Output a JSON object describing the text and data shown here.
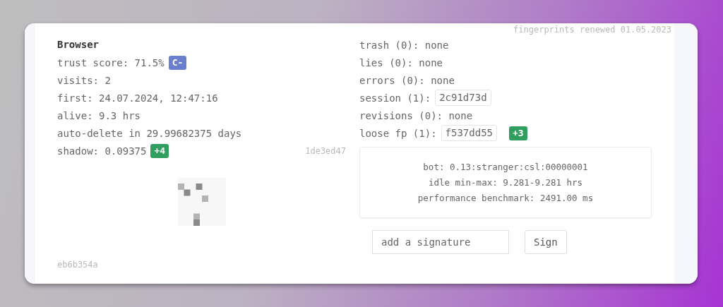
{
  "renewed": "fingerprints renewed 01.05.2023",
  "browser": {
    "title": "Browser",
    "rows": [
      {
        "text": "trust score: 71.5%",
        "badge": {
          "text": "C-",
          "color": "#6a80cf"
        }
      },
      {
        "text": "visits: 2"
      },
      {
        "text": "first: 24.07.2024, 12:47:16"
      },
      {
        "text": "alive: 9.3 hrs"
      },
      {
        "text": "auto-delete in 29.99682375 days"
      },
      {
        "text": "shadow: 0.09375",
        "badge": {
          "text": "+4",
          "color": "#2f9e5e"
        },
        "hash": "1de3ed47"
      }
    ],
    "footer_hash": "eb6b354a"
  },
  "fingerprints": [
    {
      "label": "trash (0):",
      "value": "none",
      "kind": "text"
    },
    {
      "label": "lies (0):",
      "value": "none",
      "kind": "text"
    },
    {
      "label": "errors (0):",
      "value": "none",
      "kind": "text"
    },
    {
      "label": "session (1):",
      "value": "2c91d73d",
      "kind": "code"
    },
    {
      "label": "revisions (0):",
      "value": "none",
      "kind": "text"
    },
    {
      "label": "loose fp (1):",
      "value": "f537dd55",
      "kind": "code",
      "badge": {
        "text": "+3",
        "color": "#2f9e5e"
      }
    }
  ],
  "info": [
    "bot: 0.13:stranger:csl:00000001",
    "idle min-max: 9.281-9.281 hrs",
    "performance benchmark: 2491.00 ms"
  ],
  "signature": {
    "placeholder": "add a signature",
    "button": "Sign"
  }
}
